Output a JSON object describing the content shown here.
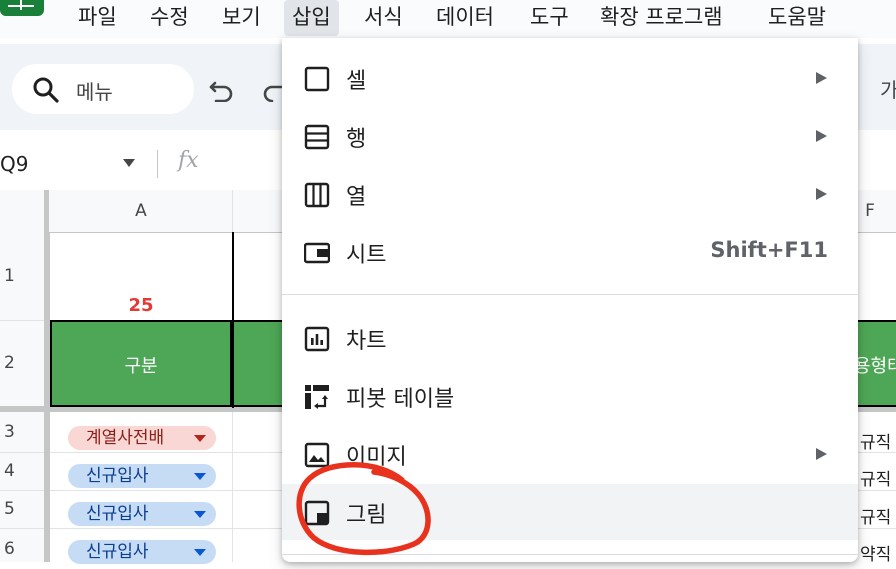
{
  "menubar": {
    "items": [
      "파일",
      "수정",
      "보기",
      "삽입",
      "서식",
      "데이터",
      "도구",
      "확장 프로그램",
      "도움말"
    ],
    "active_index": 3
  },
  "toolbar": {
    "search_label": "메뉴",
    "right_text": "가"
  },
  "formula_bar": {
    "name_box": "Q9",
    "fx_label": "fx"
  },
  "grid": {
    "columns": [
      "A",
      "F"
    ],
    "rows": [
      "1",
      "2",
      "3",
      "4",
      "5",
      "6"
    ],
    "a1_value": "25",
    "a2_header": "구분",
    "f2_header": "용형태",
    "chips": [
      {
        "text": "계열사전배",
        "color": "red"
      },
      {
        "text": "신규입사",
        "color": "blue"
      },
      {
        "text": "신규입사",
        "color": "blue"
      },
      {
        "text": "신규입사",
        "color": "blue"
      }
    ],
    "f_values": [
      "규직",
      "규직",
      "규직",
      "약직"
    ]
  },
  "insert_menu": {
    "items": [
      {
        "label": "셀",
        "icon": "cell-icon",
        "submenu": true,
        "shortcut": ""
      },
      {
        "label": "행",
        "icon": "row-icon",
        "submenu": true,
        "shortcut": ""
      },
      {
        "label": "열",
        "icon": "column-icon",
        "submenu": true,
        "shortcut": ""
      },
      {
        "label": "시트",
        "icon": "sheet-icon",
        "submenu": false,
        "shortcut": "Shift+F11"
      },
      {
        "label": "차트",
        "icon": "chart-icon",
        "submenu": false,
        "shortcut": ""
      },
      {
        "label": "피봇 테이블",
        "icon": "pivot-table-icon",
        "submenu": false,
        "shortcut": ""
      },
      {
        "label": "이미지",
        "icon": "image-icon",
        "submenu": true,
        "shortcut": ""
      },
      {
        "label": "그림",
        "icon": "drawing-icon",
        "submenu": false,
        "shortcut": ""
      }
    ],
    "hover_item": "그림"
  },
  "colors": {
    "header_green": "#4ea756",
    "accent_red": "#e53935",
    "annotation": "#e8321e"
  }
}
